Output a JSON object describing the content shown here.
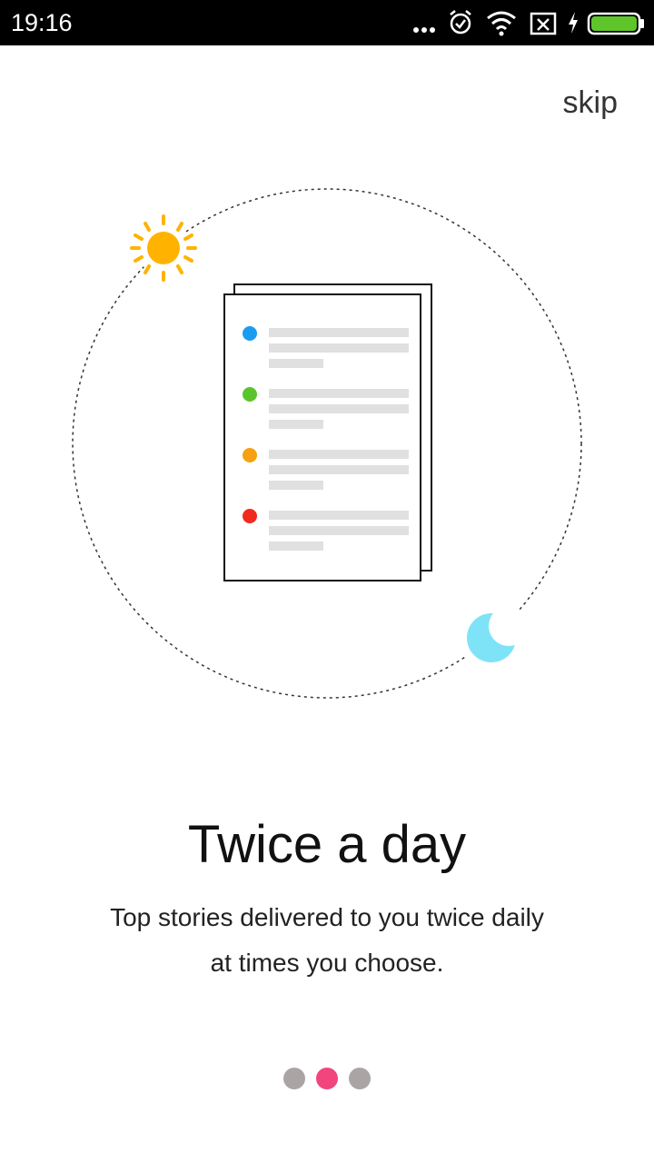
{
  "status_bar": {
    "time": "19:16",
    "icons": [
      "more-dots-icon",
      "alarm-icon",
      "wifi-icon",
      "sim-blocked-icon",
      "charging-icon",
      "battery-icon"
    ],
    "battery_color": "#5ec62a"
  },
  "skip_label": "skip",
  "illustration": {
    "sun_color": "#ffb300",
    "moon_color": "#7fe3f7",
    "list_items": [
      {
        "dot_color": "#1a9cf0"
      },
      {
        "dot_color": "#5ac42d"
      },
      {
        "dot_color": "#f5a113"
      },
      {
        "dot_color": "#f02b1d"
      }
    ]
  },
  "title": "Twice a day",
  "subtitle": {
    "line1": "Top stories delivered to you twice daily",
    "line2": "at times you choose."
  },
  "pager": {
    "pages": 3,
    "active_index": 1,
    "active_color": "#f0457d",
    "inactive_color": "#aaa5a4"
  }
}
